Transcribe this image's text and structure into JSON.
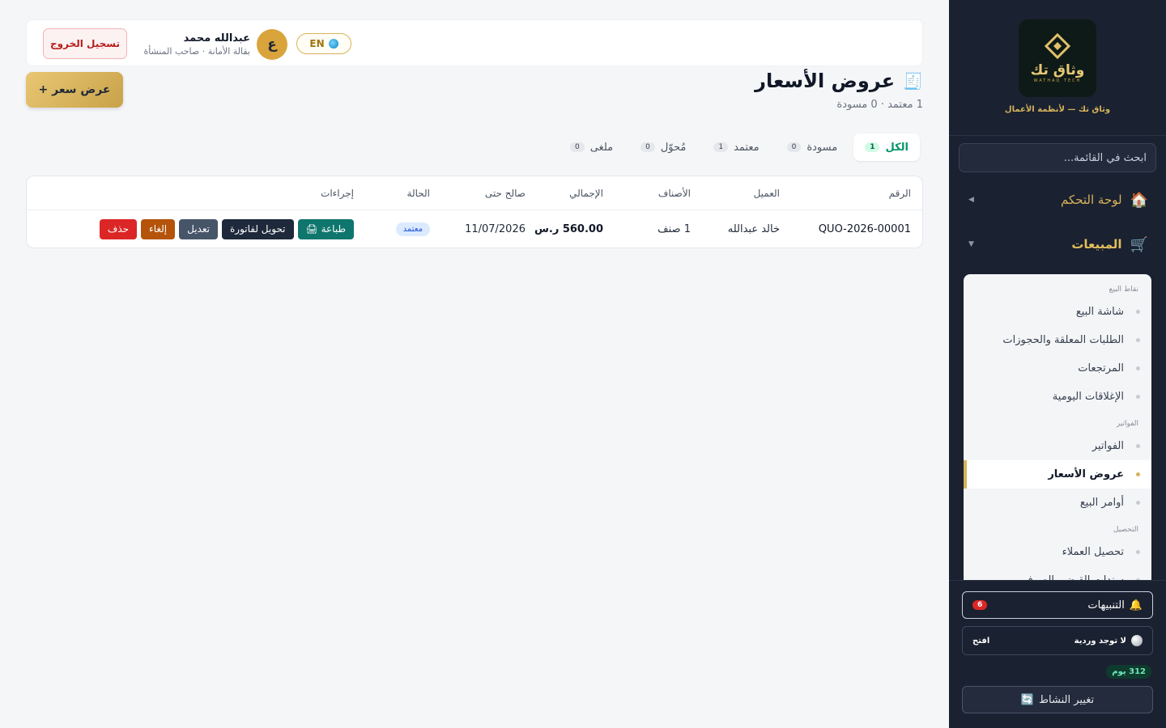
{
  "sidebar": {
    "brand_name": "وثاق تك",
    "brand_sub": "WATHAQ TECH",
    "brand_caption": "وثاق تك — لأنظمة الأعمال",
    "search_placeholder": "ابحث في القائمة...",
    "nav": [
      {
        "label": "لوحة التحكم",
        "icon": "🏠"
      },
      {
        "label": "المبيعات",
        "icon": "🛒"
      }
    ],
    "groups": [
      {
        "title": "نقاط البيع",
        "items": [
          "شاشة البيع",
          "الطلبات المعلقة والحجوزات",
          "المرتجعات",
          "الإغلاقات اليومية"
        ]
      },
      {
        "title": "الفواتير",
        "items": [
          "الفواتير",
          "عروض الأسعار",
          "أوامر البيع"
        ]
      },
      {
        "title": "التحصيل",
        "items": [
          "تحصيل العملاء",
          "سندات القبض والصرف"
        ]
      }
    ],
    "active_item": "عروض الأسعار",
    "alerts_label": "التنبيهات",
    "alerts_icon": "🔔",
    "alerts_count": "6",
    "shift_label": "لا توجد وردية",
    "shift_action": "افتح",
    "days_left": "312 يوم",
    "change_activity": "تغيير النشاط",
    "change_icon": "🔄"
  },
  "header": {
    "logout": "تسجيل الخروج",
    "user_name": "عبدالله محمد",
    "user_role": "بقالة الأمانة · صاحب المنشأة",
    "avatar_letter": "ع",
    "lang": "EN"
  },
  "page": {
    "icon": "🧾",
    "title": "عروض الأسعار",
    "subtitle": "1 معتمد · 0 مسودة",
    "new_button": "+ عرض سعر"
  },
  "tabs": [
    {
      "label": "الكل",
      "count": "1"
    },
    {
      "label": "مسودة",
      "count": "0"
    },
    {
      "label": "معتمد",
      "count": "1"
    },
    {
      "label": "مُحوّل",
      "count": "0"
    },
    {
      "label": "ملغى",
      "count": "0"
    }
  ],
  "table": {
    "headers": {
      "number": "الرقم",
      "customer": "العميل",
      "items": "الأصناف",
      "total": "الإجمالي",
      "valid_until": "صالح حتى",
      "status": "الحالة",
      "actions": "إجراءات"
    },
    "rows": [
      {
        "number": "QUO-2026-00001",
        "customer": "خالد عبدالله",
        "items": "1 صنف",
        "total": "560.00 ر.س",
        "valid_until": "11/07/2026",
        "status": "معتمد"
      }
    ],
    "actions": {
      "print": "طباعة",
      "print_icon": "🖨",
      "convert": "تحويل لفاتورة",
      "edit": "تعديل",
      "cancel": "إلغاء",
      "delete": "حذف"
    }
  },
  "colors": {
    "sidebar_bg": "#1a2130",
    "accent_gold": "#d8b35a",
    "tab_active": "#059669",
    "status_blue": "#1d4ed8",
    "danger": "#dc2626"
  }
}
